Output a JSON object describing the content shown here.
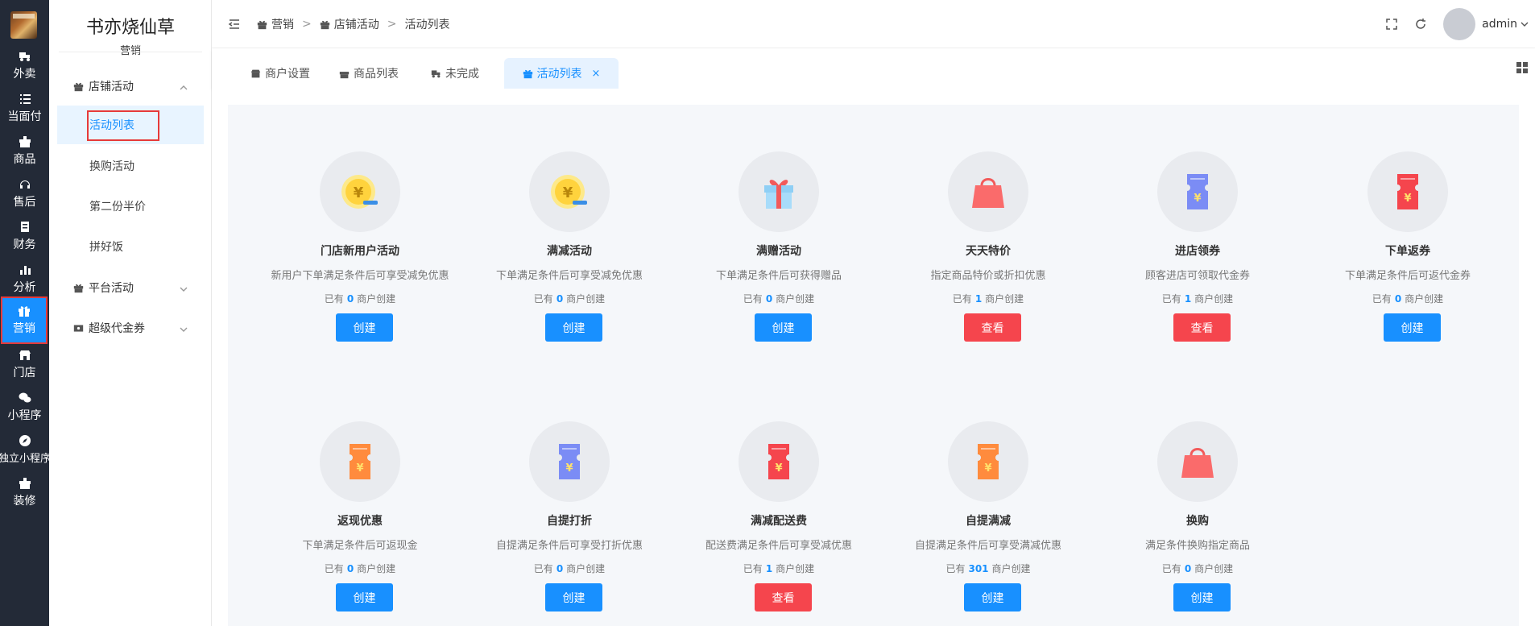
{
  "rail": {
    "items": [
      {
        "label": "外卖",
        "icon": "delivery-icon"
      },
      {
        "label": "当面付",
        "icon": "list-icon"
      },
      {
        "label": "商品",
        "icon": "goods-icon"
      },
      {
        "label": "售后",
        "icon": "headset-icon"
      },
      {
        "label": "财务",
        "icon": "finance-icon"
      },
      {
        "label": "分析",
        "icon": "bar-chart-icon"
      },
      {
        "label": "营销",
        "icon": "gift-icon"
      },
      {
        "label": "门店",
        "icon": "store-icon"
      },
      {
        "label": "小程序",
        "icon": "wechat-icon"
      },
      {
        "label": "独立小程序",
        "icon": "compass-icon"
      },
      {
        "label": "装修",
        "icon": "brush-icon"
      }
    ]
  },
  "sidebar": {
    "shop_name": "书亦烧仙草",
    "module": "营销",
    "groups": {
      "store_activity": "店铺活动",
      "platform_activity": "平台活动",
      "super_coupon": "超级代金券"
    },
    "sub_items": [
      "活动列表",
      "换购活动",
      "第二份半价",
      "拼好饭"
    ]
  },
  "breadcrumb": [
    "营销",
    "店铺活动",
    "活动列表"
  ],
  "header": {
    "user": "admin"
  },
  "tabs": [
    {
      "label": "商户设置"
    },
    {
      "label": "商品列表"
    },
    {
      "label": "未完成"
    },
    {
      "label": "活动列表",
      "close": "×"
    }
  ],
  "count_prefix": "已有",
  "count_suffix": "商户创建",
  "cards": [
    {
      "title": "门店新用户活动",
      "desc": "新用户下单满足条件后可享受减免优惠",
      "count": "0",
      "button": "创建",
      "button_type": "primary",
      "icon": "coin-icon"
    },
    {
      "title": "满减活动",
      "desc": "下单满足条件后可享受减免优惠",
      "count": "0",
      "button": "创建",
      "button_type": "primary",
      "icon": "coin-icon"
    },
    {
      "title": "满赠活动",
      "desc": "下单满足条件后可获得赠品",
      "count": "0",
      "button": "创建",
      "button_type": "primary",
      "icon": "gift-box-icon"
    },
    {
      "title": "天天特价",
      "desc": "指定商品特价或折扣优惠",
      "count": "1",
      "button": "查看",
      "button_type": "danger",
      "icon": "shopping-bag-icon"
    },
    {
      "title": "进店领券",
      "desc": "顾客进店可领取代金券",
      "count": "1",
      "button": "查看",
      "button_type": "danger",
      "icon": "ticket-icon"
    },
    {
      "title": "下单返券",
      "desc": "下单满足条件后可返代金券",
      "count": "0",
      "button": "创建",
      "button_type": "primary",
      "icon": "ticket-icon"
    },
    {
      "title": "返现优惠",
      "desc": "下单满足条件后可返现金",
      "count": "0",
      "button": "创建",
      "button_type": "primary",
      "icon": "ticket-icon"
    },
    {
      "title": "自提打折",
      "desc": "自提满足条件后可享受打折优惠",
      "count": "0",
      "button": "创建",
      "button_type": "primary",
      "icon": "ticket-icon"
    },
    {
      "title": "满减配送费",
      "desc": "配送费满足条件后可享受减优惠",
      "count": "1",
      "button": "查看",
      "button_type": "danger",
      "icon": "ticket-icon"
    },
    {
      "title": "自提满减",
      "desc": "自提满足条件后可享受满减优惠",
      "count": "301",
      "button": "创建",
      "button_type": "primary",
      "icon": "ticket-icon"
    },
    {
      "title": "换购",
      "desc": "满足条件换购指定商品",
      "count": "0",
      "button": "创建",
      "button_type": "primary",
      "icon": "shopping-bag-icon"
    }
  ],
  "colors": {
    "rail_bg": "#232a37",
    "primary": "#1890ff",
    "danger": "#f5454d",
    "highlight_border": "#e63a3a",
    "ticket_orange": "#ff8b3d",
    "ticket_blue": "#7b8cf5",
    "ticket_red": "#f5454d",
    "coin_yellow": "#ffd33d"
  }
}
